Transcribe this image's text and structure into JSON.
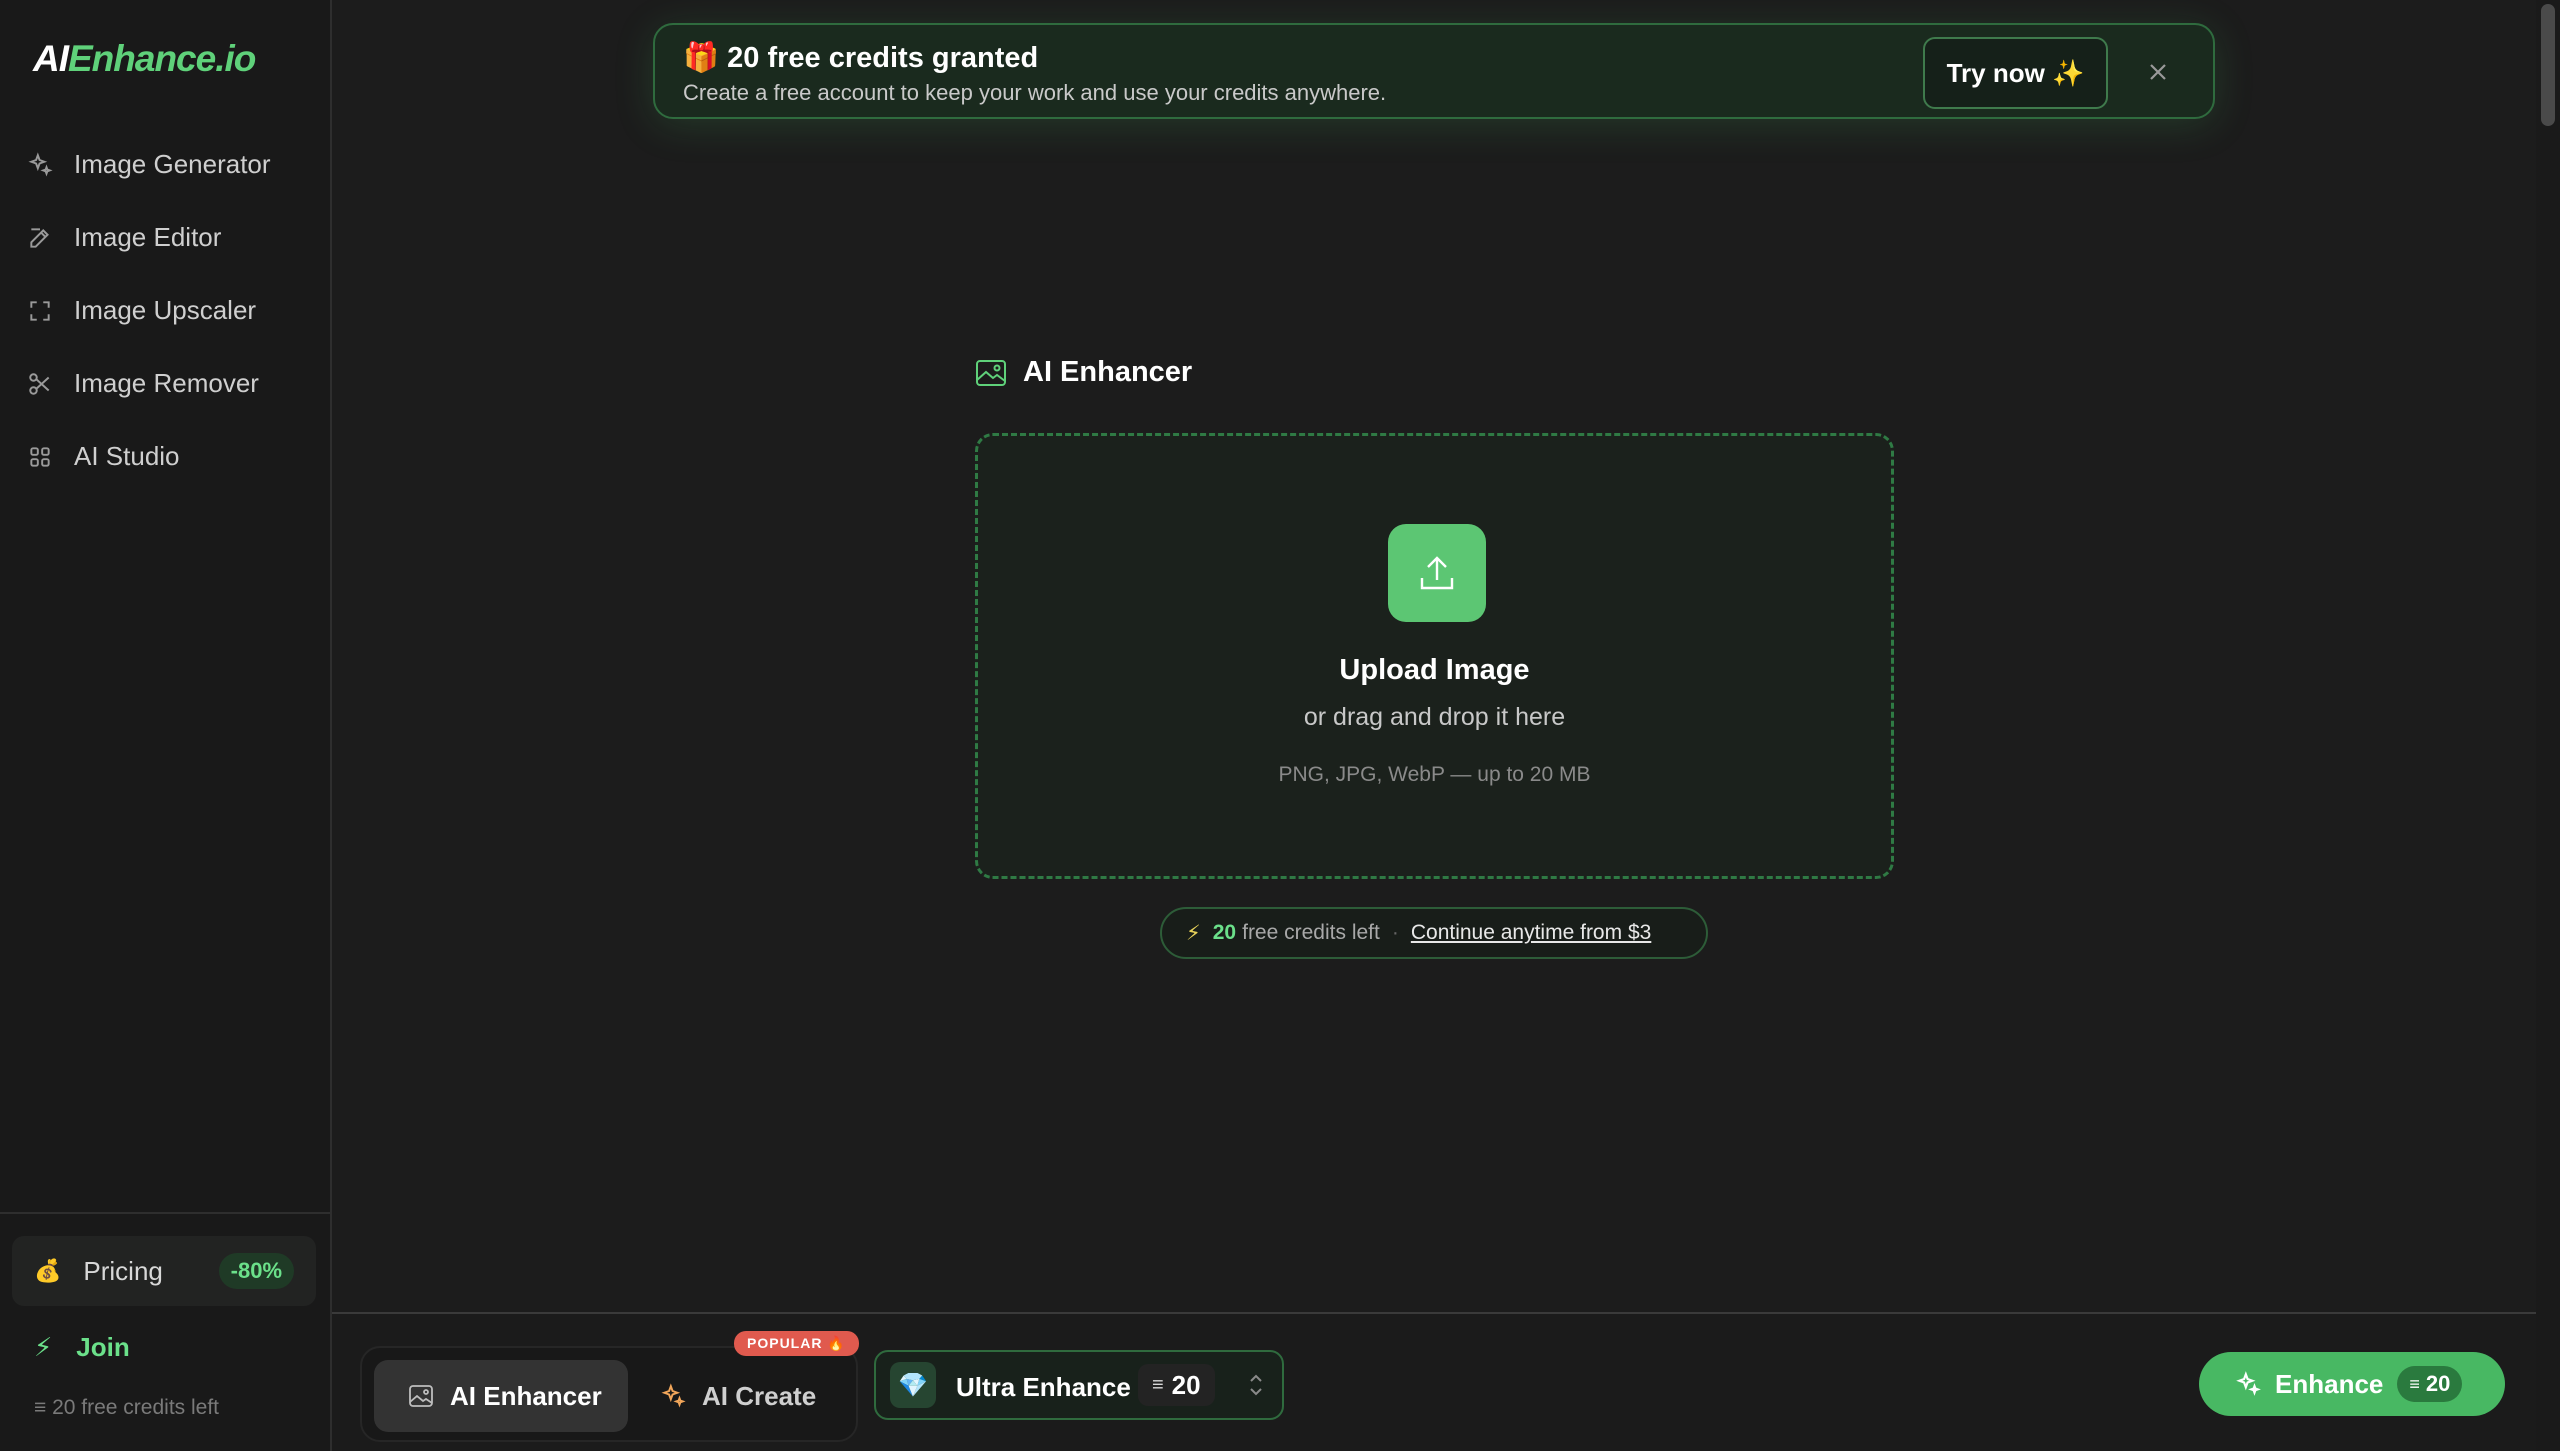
{
  "logo": {
    "part1": "AI",
    "part2": "Enhance.io"
  },
  "sidebar": {
    "items": [
      {
        "label": "Image Generator",
        "icon": "sparkles-icon"
      },
      {
        "label": "Image Editor",
        "icon": "edit-icon"
      },
      {
        "label": "Image Upscaler",
        "icon": "expand-icon"
      },
      {
        "label": "Image Remover",
        "icon": "scissors-icon"
      },
      {
        "label": "AI Studio",
        "icon": "grid-icon"
      }
    ],
    "pricing": {
      "label": "Pricing",
      "badge": "-80%",
      "icon": "money-bag-icon"
    },
    "join": {
      "label": "Join",
      "icon": "bolt-icon"
    },
    "credits_left": "20 free credits left"
  },
  "banner": {
    "emoji": "🎁",
    "title": "20 free credits granted",
    "subtitle": "Create a free account to keep your work and use your credits anywhere.",
    "cta": "Try now ✨"
  },
  "main": {
    "section_title": "AI Enhancer",
    "upload": {
      "title": "Upload Image",
      "subtitle": "or drag and drop it here",
      "formats": "PNG, JPG, WebP — up to 20 MB"
    },
    "credits": {
      "count": "20",
      "text": "free credits left",
      "separator": "·",
      "link": "Continue anytime from $3"
    }
  },
  "bottom_bar": {
    "modes": [
      {
        "label": "AI Enhancer",
        "active": true
      },
      {
        "label": "AI Create",
        "active": false,
        "badge": "POPULAR 🔥"
      }
    ],
    "model": {
      "label": "Ultra Enhance",
      "cost": "20",
      "icon": "gem-icon"
    },
    "enhance": {
      "label": "Enhance",
      "cost": "20"
    }
  },
  "colors": {
    "accent": "#5cc673",
    "background": "#1c1c1c",
    "badge_red": "#e05a4e"
  }
}
